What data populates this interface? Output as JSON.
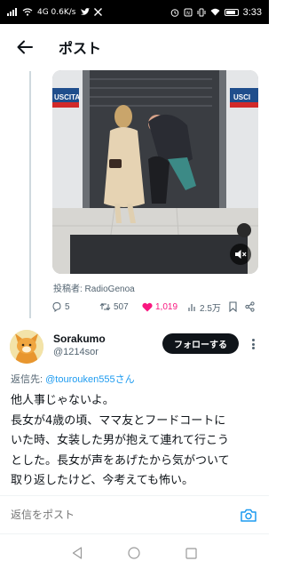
{
  "status_bar": {
    "left_info": "4G 0.6K/s",
    "time": "3:33",
    "battery_pct": 0.75
  },
  "header": {
    "title": "ポスト"
  },
  "quoted_post": {
    "poster_label": "投稿者: RadioGenoa",
    "video_sign_text": "USCITA",
    "actions": {
      "replies": "5",
      "reposts": "507",
      "likes": "1,019",
      "views": "2.5万"
    }
  },
  "reply_post": {
    "display_name": "Sorakumo",
    "handle": "@1214sor",
    "follow_label": "フォローする",
    "replying_prefix": "返信先: ",
    "replying_to": "@tourouken555さん",
    "body_lines": [
      "他人事じゃないよ。",
      "長女が4歳の頃、ママ友とフードコートに",
      "いた時、女装した男が抱えて連れて行こう",
      "とした。長女が声をあげたから気がついて",
      "取り返したけど、今考えても怖い。"
    ]
  },
  "reply_bar": {
    "placeholder": "返信をポスト"
  },
  "colors": {
    "accent": "#1d9bf0",
    "like": "#f91880",
    "text": "#0f1419",
    "muted": "#536471"
  },
  "icons": [
    "back-arrow-icon",
    "reply-icon",
    "repost-icon",
    "heart-icon",
    "views-icon",
    "bookmark-icon",
    "share-icon",
    "mute-icon",
    "camera-icon",
    "more-icon",
    "nav-back-icon",
    "nav-home-icon",
    "nav-recents-icon"
  ]
}
